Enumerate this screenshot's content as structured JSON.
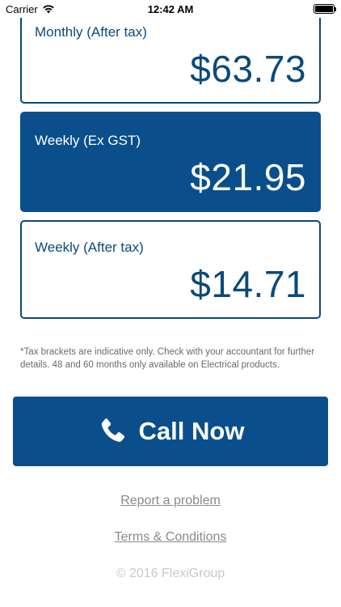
{
  "status_bar": {
    "carrier": "Carrier",
    "time": "12:42 AM"
  },
  "cards": {
    "monthly_after_tax": {
      "label": "Monthly (After tax)",
      "value": "$63.73"
    },
    "weekly_ex_gst": {
      "label": "Weekly (Ex GST)",
      "value": "$21.95"
    },
    "weekly_after_tax": {
      "label": "Weekly (After tax)",
      "value": "$14.71"
    }
  },
  "disclaimer": "*Tax brackets are indicative only. Check with your accountant for further details. 48 and 60 months only available on Electrical products.",
  "call_button": {
    "label": "Call Now",
    "icon": "phone-icon"
  },
  "links": {
    "report": "Report a problem",
    "terms": "Terms & Conditions"
  },
  "footer": {
    "copyright": "© 2016 FlexiGroup"
  },
  "colors": {
    "primary": "#0a4f8c",
    "link": "#8a8a8a",
    "copyright": "#c9c9c9"
  }
}
